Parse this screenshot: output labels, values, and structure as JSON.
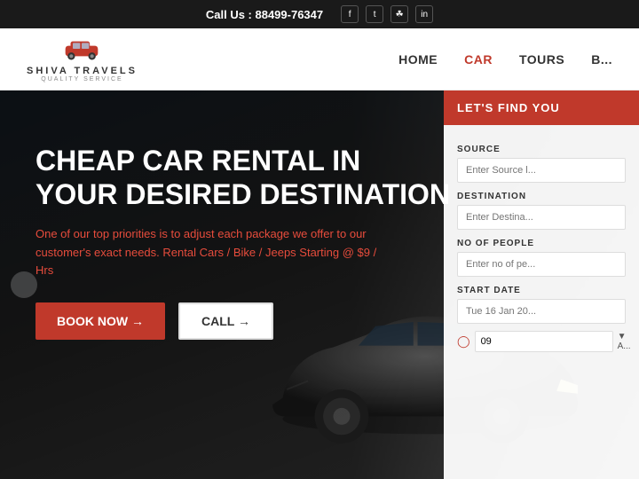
{
  "topbar": {
    "cta": "Call Us : 88499-76347",
    "socials": [
      "f",
      "t",
      "ig",
      "in"
    ]
  },
  "navbar": {
    "logo_name": "SHIVA TRAVELS",
    "logo_sub": "QUALITY SERVICE",
    "links": [
      "HOME",
      "CAR",
      "TOURS",
      "B..."
    ]
  },
  "hero": {
    "title_line1": "CHEAP CAR RENTAL IN",
    "title_line2": "YOUR DESIRED DESTINATION",
    "description": "One of our top priorities is to adjust each package we offer to our customer's exact needs. Rental Cars / Bike / Jeeps",
    "desc_highlight": "Starting @ $9 / Hrs",
    "btn_book": "BOOK NOW →",
    "btn_call": "CALL →"
  },
  "booking_panel": {
    "header": "LET'S FIND YOU",
    "source_label": "SOURCE",
    "source_placeholder": "Enter Source l...",
    "destination_label": "DESTINATION",
    "destination_placeholder": "Enter Destina...",
    "people_label": "NO OF PEOPLE",
    "people_placeholder": "Enter no of pe...",
    "date_label": "START DATE",
    "date_value": "Tue 16 Jan 20...",
    "time_value": "09",
    "time_unit": "▼ A..."
  }
}
